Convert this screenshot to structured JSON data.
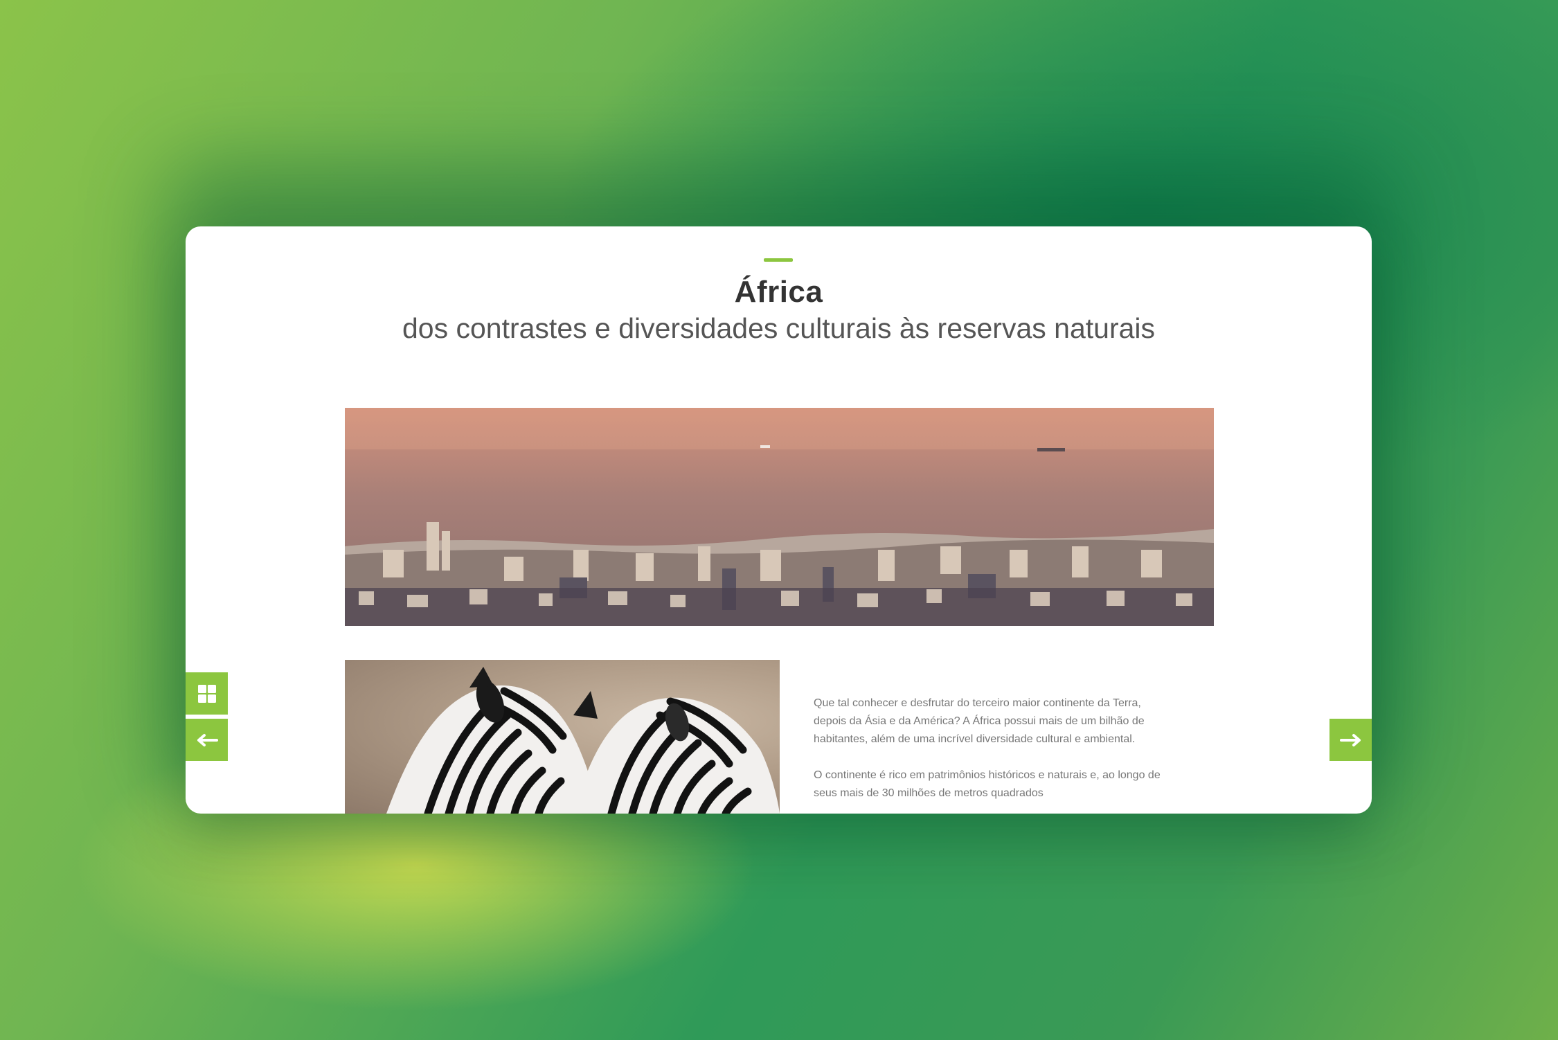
{
  "header": {
    "title": "África",
    "subtitle": "dos contrastes e diversidades culturais às reservas naturais"
  },
  "images": {
    "hero": "coastal-city-aerial-image",
    "secondary": "zebras-image"
  },
  "content": {
    "paragraph_1": "Que tal conhecer e desfrutar do terceiro maior continente da Terra, depois da Ásia e da América? A África possui mais de um bilhão de habitantes, além de uma incrível diversidade cultural e ambiental.",
    "paragraph_2": "O continente é rico em patrimônios históricos e naturais e, ao longo de seus mais de 30 milhões de metros quadrados"
  },
  "navigation": {
    "grid_icon": "grid-icon",
    "prev_icon": "arrow-left-icon",
    "next_icon": "arrow-right-icon"
  },
  "colors": {
    "accent": "#8cc63f",
    "title": "#333333",
    "subtitle": "#555555",
    "body_text": "#777777",
    "card": "#ffffff"
  }
}
